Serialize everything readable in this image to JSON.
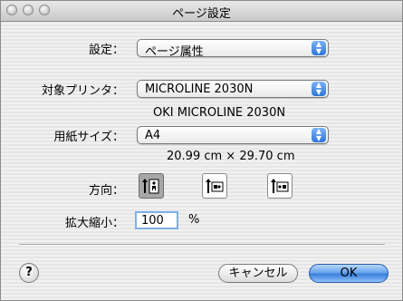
{
  "window": {
    "title": "ページ設定"
  },
  "settings": {
    "label": "設定：",
    "value": "ページ属性"
  },
  "printer": {
    "label": "対象プリンタ：",
    "value": "MICROLINE 2030N",
    "detail": "OKI MICROLINE 2030N"
  },
  "paper": {
    "label": "用紙サイズ：",
    "value": "A4",
    "dimensions": "20.99 cm × 29.70 cm"
  },
  "orientation": {
    "label": "方向：",
    "options": [
      "portrait",
      "landscape-left",
      "landscape-right"
    ],
    "selected": "portrait"
  },
  "scale": {
    "label": "拡大縮小：",
    "value": "100",
    "unit": "%"
  },
  "buttons": {
    "help": "?",
    "cancel": "キャンセル",
    "ok": "OK"
  },
  "colors": {
    "accent": "#3a7fdc",
    "popup_arrow": "#2f74d6",
    "selected_orientation": "#a7a7a7"
  }
}
